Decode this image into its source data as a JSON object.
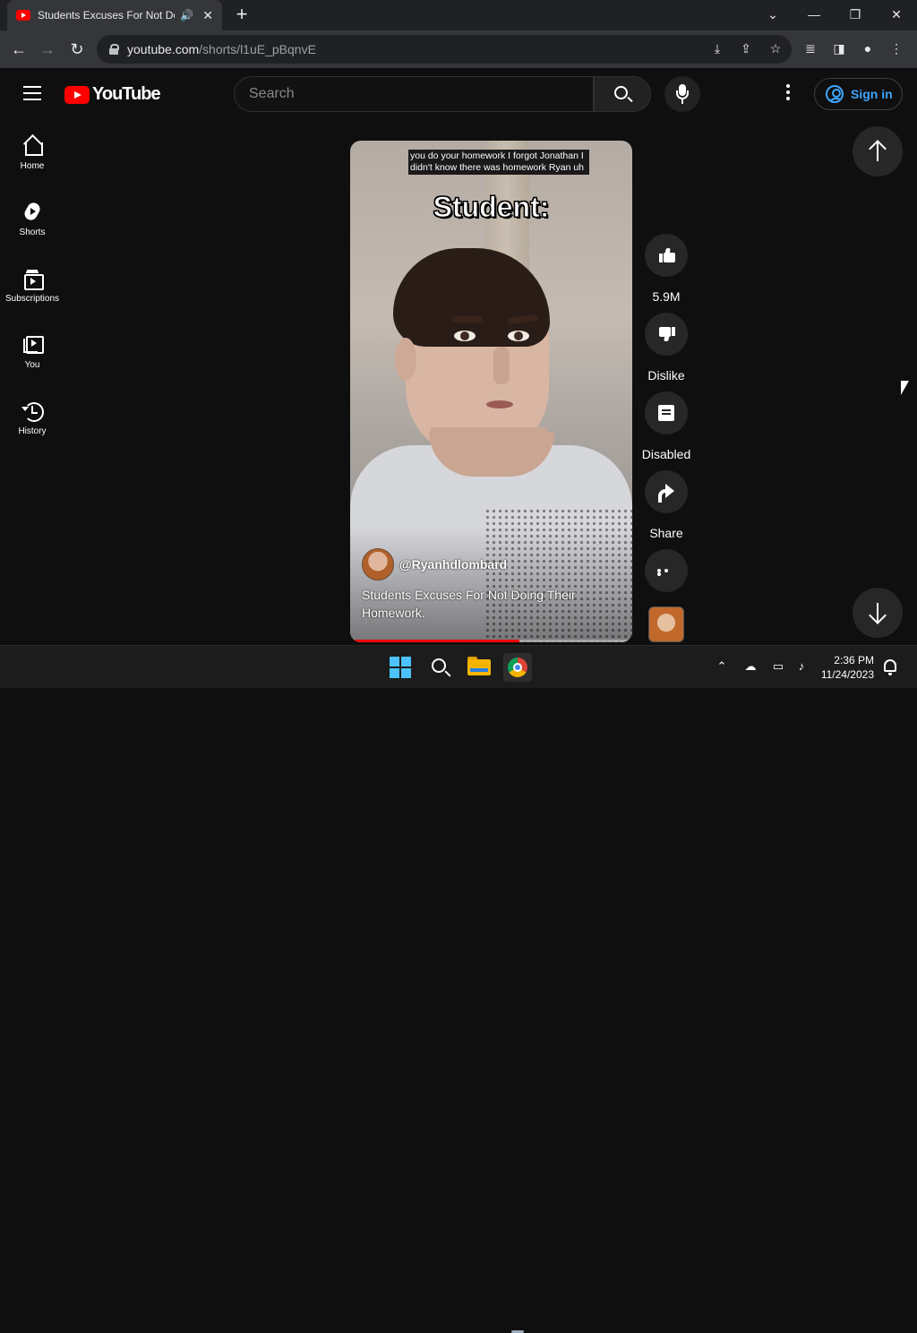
{
  "browser": {
    "tab_title": "Students Excuses For Not Do",
    "speaker_glyph": "🔊",
    "close_glyph": "✕",
    "new_tab_glyph": "+",
    "url_host": "youtube.com",
    "url_path": "/shorts/l1uE_pBqnvE",
    "window_minimize": "—",
    "window_restore": "❐",
    "window_close": "✕",
    "window_menu": "⌄",
    "back_glyph": "←",
    "forward_glyph": "→",
    "reload_glyph": "↻"
  },
  "youtube": {
    "logo_text": "YouTube",
    "search_placeholder": "Search",
    "signin_label": "Sign in",
    "accent": "#3ea6ff",
    "brand_red": "#ff0000"
  },
  "sidebar": {
    "items": [
      {
        "label": "Home",
        "icon": "home-icon"
      },
      {
        "label": "Shorts",
        "icon": "shorts-icon"
      },
      {
        "label": "Subscriptions",
        "icon": "subscriptions-icon"
      },
      {
        "label": "You",
        "icon": "you-icon"
      },
      {
        "label": "History",
        "icon": "history-icon"
      }
    ]
  },
  "short": {
    "caption": "you do your homework I forgot Jonathan I didn't know there was homework Ryan uh",
    "overlay_title": "Student:",
    "channel_handle": "@Ryanhdlombard",
    "description": "Students Excuses For Not Doing Their Homework.",
    "progress": 0.6
  },
  "actions": {
    "like_count": "5.9M",
    "dislike_label": "Dislike",
    "comments_label": "Disabled",
    "share_label": "Share"
  },
  "taskbar": {
    "time": "2:36 PM",
    "date": "11/24/2023",
    "tray_chevron": "⌃"
  }
}
